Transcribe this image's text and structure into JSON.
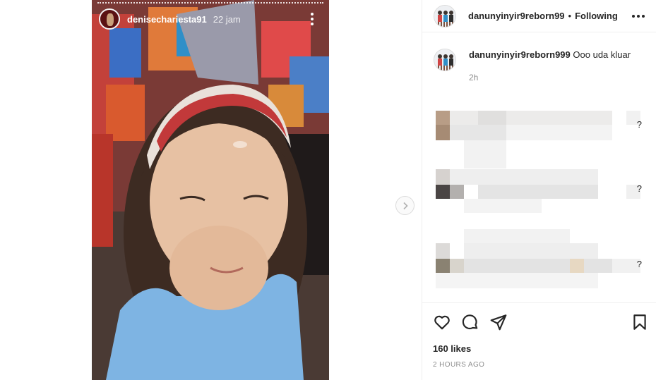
{
  "story": {
    "username": "denisechariesta91",
    "time": "22 jam"
  },
  "post": {
    "username": "danunyinyir9reborn99",
    "separator": "•",
    "follow_status": "Following"
  },
  "caption": {
    "username": "danunyinyir9reborn999",
    "text": "Ooo uda kluar",
    "age": "2h"
  },
  "comments_placeholder": {
    "suffix_1": "?",
    "suffix_2": "?",
    "suffix_3": "?"
  },
  "engagement": {
    "likes": "160 likes",
    "posted": "2 HOURS AGO"
  },
  "icons": {
    "like": "heart-icon",
    "comment": "comment-icon",
    "share": "paper-plane-icon",
    "save": "bookmark-icon",
    "next": "chevron-right-icon",
    "options": "more-icon"
  },
  "colors": {
    "text": "#262626",
    "muted": "#8e8e8e",
    "divider": "#efefef"
  }
}
